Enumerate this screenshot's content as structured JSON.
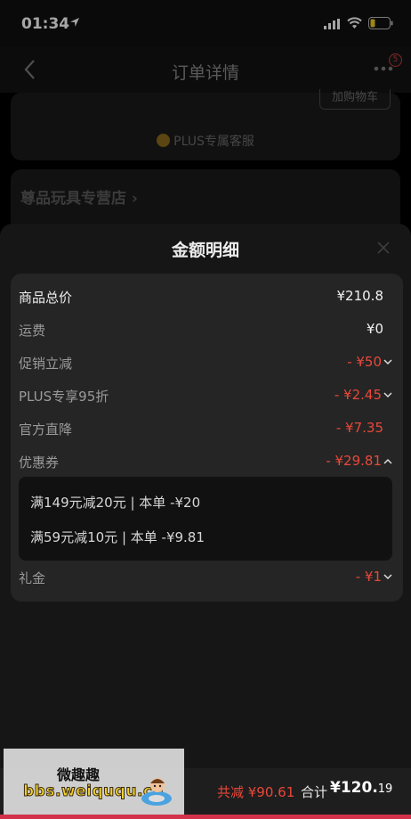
{
  "status_bar": {
    "time": "01:34"
  },
  "nav": {
    "title": "订单详情",
    "badge": "5"
  },
  "background": {
    "cart_button": "加购物车",
    "plus_service": "PLUS专属客服",
    "store_name": "尊品玩具专营店 ›"
  },
  "sheet": {
    "title": "金额明细",
    "rows": [
      {
        "label": "商品总价",
        "value": "¥210.8"
      },
      {
        "label": "运费",
        "value": "¥0"
      },
      {
        "label": "促销立减",
        "value": "- ¥50"
      },
      {
        "label": "PLUS专享95折",
        "value": "- ¥2.45"
      },
      {
        "label": "官方直降",
        "value": "- ¥7.35"
      },
      {
        "label": "优惠券",
        "value": "- ¥29.81"
      },
      {
        "label": "礼金",
        "value": "- ¥1"
      }
    ],
    "coupons": [
      "满149元减20元 | 本单 -¥20",
      "满59元减10元 | 本单 -¥9.81"
    ]
  },
  "bottom": {
    "discount": "共减 ¥90.61",
    "total_label": "合计",
    "total_int": "¥120.",
    "total_dec": "19"
  },
  "watermark": {
    "title": "微趣趣",
    "url": "bbs.weiququ.cn"
  },
  "colors": {
    "accent_red": "#e8483a",
    "sheet_bg": "#161616",
    "card_bg": "#252525"
  }
}
